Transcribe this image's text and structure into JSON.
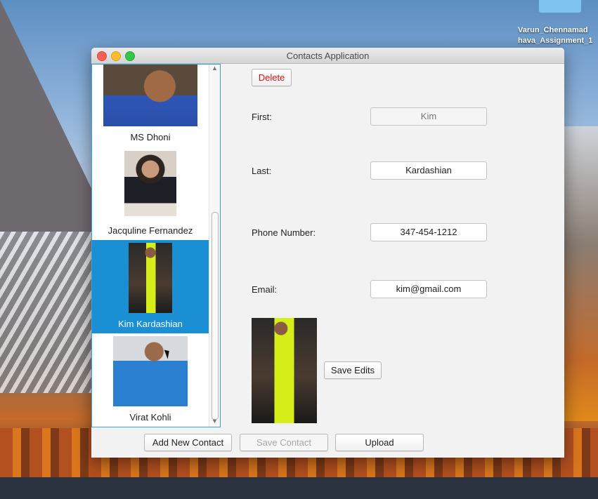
{
  "desktop": {
    "file_label_line1": "Varun_Chennamad",
    "file_label_line2": "hava_Assignment_1"
  },
  "window": {
    "title": "Contacts Application"
  },
  "contacts": [
    {
      "name": "MS Dhoni",
      "selected": false
    },
    {
      "name": "Jacquline Fernandez",
      "selected": false
    },
    {
      "name": "Kim Kardashian",
      "selected": true
    },
    {
      "name": "Virat Kohli",
      "selected": false
    }
  ],
  "form": {
    "delete_label": "Delete",
    "first_label": "First:",
    "first_value": "Kim",
    "last_label": "Last:",
    "last_value": "Kardashian",
    "phone_label": "Phone Number:",
    "phone_value": "347-454-1212",
    "email_label": "Email:",
    "email_value": "kim@gmail.com",
    "save_edits_label": "Save Edits"
  },
  "footer": {
    "add_label": "Add New Contact",
    "save_label": "Save Contact",
    "upload_label": "Upload"
  },
  "colors": {
    "selection": "#1a8fd3",
    "delete_text": "#d21414",
    "list_border": "#3aa0d8"
  }
}
